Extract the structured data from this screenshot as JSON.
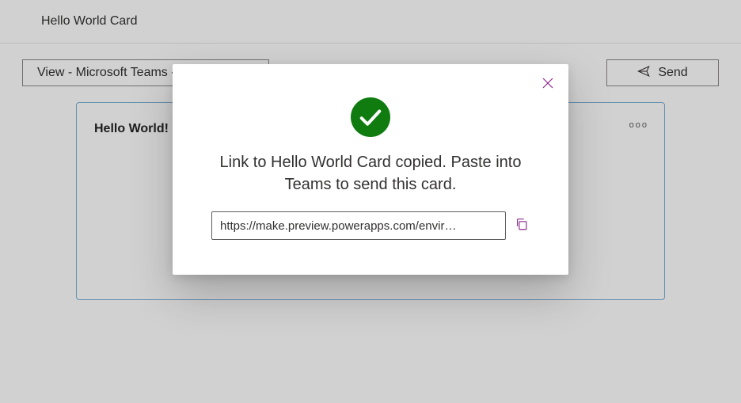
{
  "header": {
    "title": "Hello World Card"
  },
  "toolbar": {
    "view_label": "View - Microsoft Teams -",
    "send_label": "Send"
  },
  "card": {
    "title": "Hello World!",
    "more": "ooo"
  },
  "modal": {
    "message": "Link to Hello World Card copied. Paste into Teams to send this card.",
    "link_value": "https://make.preview.powerapps.com/envir…"
  }
}
